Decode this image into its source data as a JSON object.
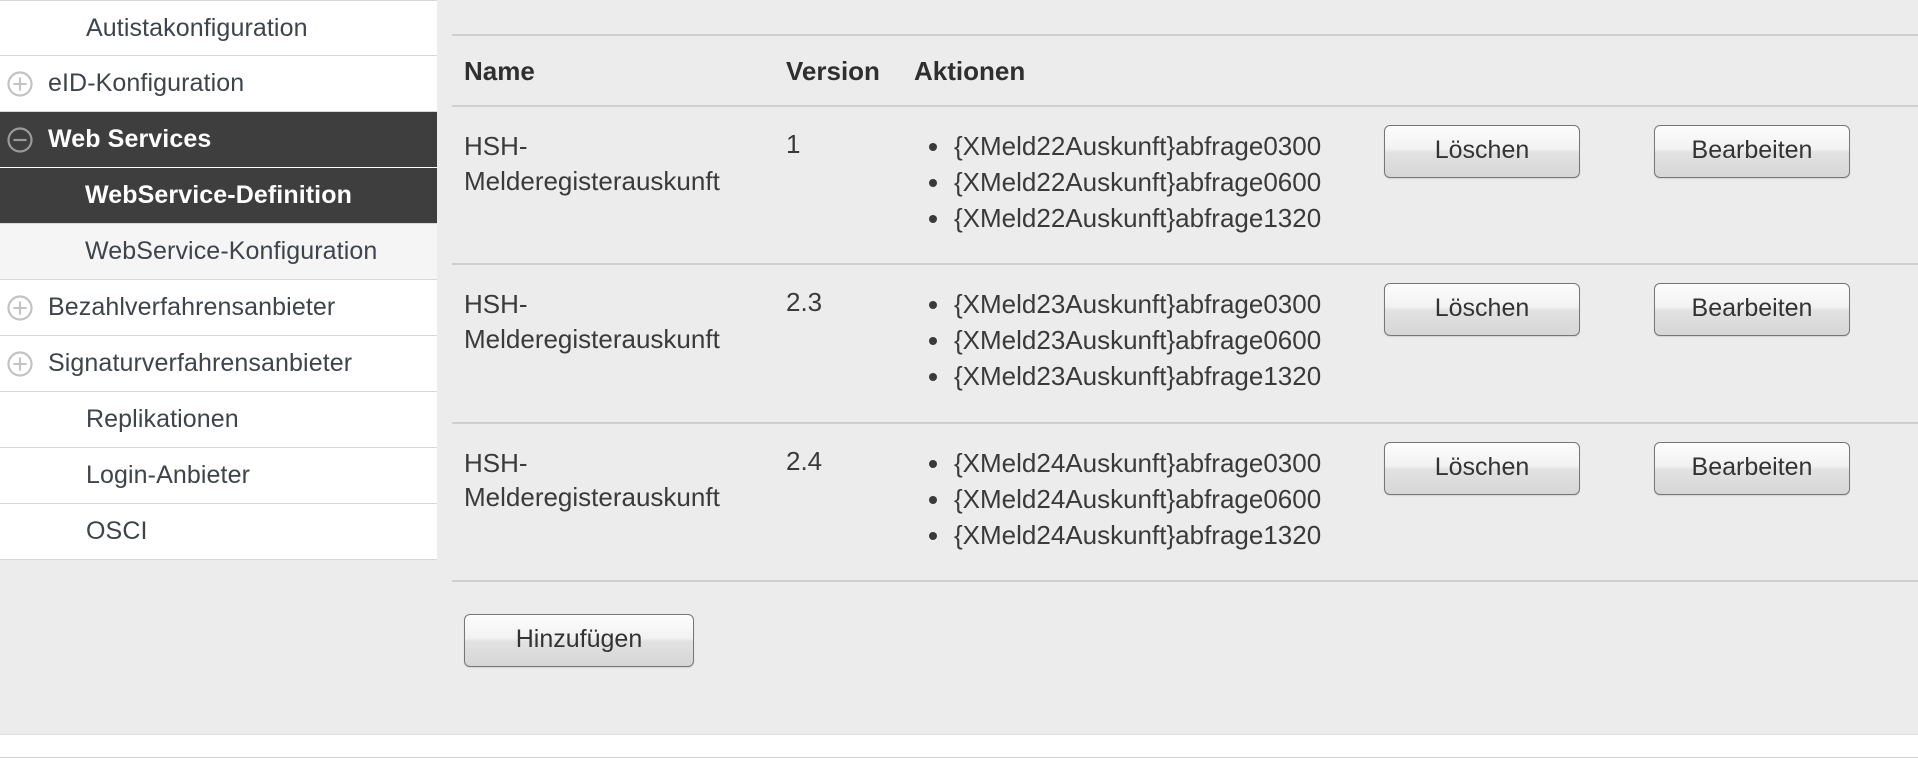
{
  "sidebar": {
    "items": [
      {
        "label": "Autistakonfiguration",
        "icon": "none",
        "level": 0,
        "selected": false
      },
      {
        "label": "eID-Konfiguration",
        "icon": "plus-circle-icon",
        "level": 0,
        "selected": false
      },
      {
        "label": "Web Services",
        "icon": "minus-circle-icon",
        "level": 0,
        "selected": true
      },
      {
        "label": "WebService-Definition",
        "icon": "none",
        "level": 1,
        "selected": true
      },
      {
        "label": "WebService-Konfiguration",
        "icon": "none",
        "level": 1,
        "selected": false
      },
      {
        "label": "Bezahlverfahrensanbieter",
        "icon": "plus-circle-icon",
        "level": 0,
        "selected": false
      },
      {
        "label": "Signaturverfahrensanbieter",
        "icon": "plus-circle-icon",
        "level": 0,
        "selected": false
      },
      {
        "label": "Replikationen",
        "icon": "none",
        "level": 0,
        "selected": false
      },
      {
        "label": "Login-Anbieter",
        "icon": "none",
        "level": 0,
        "selected": false
      },
      {
        "label": "OSCI",
        "icon": "none",
        "level": 0,
        "selected": false
      }
    ]
  },
  "main": {
    "table": {
      "headers": {
        "name": "Name",
        "version": "Version",
        "aktionen": "Aktionen"
      },
      "rows": [
        {
          "name": "HSH-Melderegisterauskunft",
          "version": "1",
          "actions": [
            "{XMeld22Auskunft}abfrage0300",
            "{XMeld22Auskunft}abfrage0600",
            "{XMeld22Auskunft}abfrage1320"
          ],
          "delete_label": "Löschen",
          "edit_label": "Bearbeiten"
        },
        {
          "name": "HSH-Melderegisterauskunft",
          "version": "2.3",
          "actions": [
            "{XMeld23Auskunft}abfrage0300",
            "{XMeld23Auskunft}abfrage0600",
            "{XMeld23Auskunft}abfrage1320"
          ],
          "delete_label": "Löschen",
          "edit_label": "Bearbeiten"
        },
        {
          "name": "HSH-Melderegisterauskunft",
          "version": "2.4",
          "actions": [
            "{XMeld24Auskunft}abfrage0300",
            "{XMeld24Auskunft}abfrage0600",
            "{XMeld24Auskunft}abfrage1320"
          ],
          "delete_label": "Löschen",
          "edit_label": "Bearbeiten"
        }
      ]
    },
    "add_button_label": "Hinzufügen"
  },
  "colors": {
    "selected_nav_bg": "#3e3e3e",
    "content_bg": "#ececec",
    "nav_bg": "#ffffff",
    "child_nav_bg": "#f5f5f5",
    "rule": "#cfcfcf",
    "text": "#3a3a3a"
  }
}
